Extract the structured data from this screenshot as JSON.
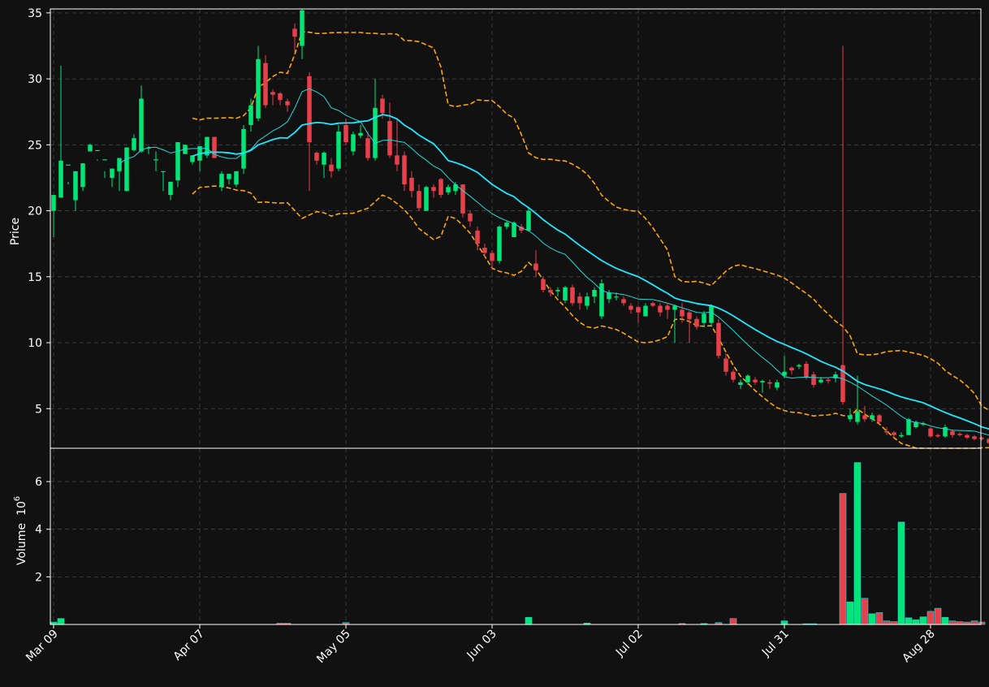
{
  "chart_data": {
    "type": "candlestick",
    "price_panel": {
      "ylabel": "Price",
      "ylim": [
        2,
        35.3
      ],
      "yticks": [
        5,
        10,
        15,
        20,
        25,
        30,
        35
      ],
      "grid": true
    },
    "volume_panel": {
      "ylabel": "Volume",
      "ylabel_exponent": "6",
      "ylim": [
        0,
        7.4
      ],
      "yticks": [
        2,
        4,
        6
      ],
      "grid": true
    },
    "x_tick_labels": [
      "Mar 09",
      "Apr 07",
      "May 05",
      "Jun 03",
      "Jul 02",
      "Jul 31",
      "Aug 28"
    ],
    "x_tick_index": [
      0,
      20,
      40,
      60,
      80,
      100,
      120
    ],
    "colors": {
      "up": "#00e676",
      "down": "#e8404a",
      "ma_fast": "#22d8d8",
      "ma_slow": "#1ee8ff",
      "bands": "#ffa500",
      "background": "#111111",
      "grid": "#444444"
    },
    "candles": [
      [
        20.0,
        21.2,
        18.0,
        21.2
      ],
      [
        21.0,
        23.8,
        21.0,
        31.0
      ],
      [
        23.5,
        23.5,
        22.0,
        22.2
      ],
      [
        20.8,
        23.0,
        20.0,
        23.0
      ],
      [
        21.8,
        23.6,
        21.5,
        23.6
      ],
      [
        24.5,
        25.0,
        24.5,
        25.1
      ],
      [
        24.6,
        24.6,
        23.8,
        23.9
      ],
      [
        23.9,
        23.9,
        22.5,
        23.0
      ],
      [
        22.5,
        23.2,
        21.8,
        23.2
      ],
      [
        23.0,
        24.0,
        21.5,
        24.0
      ],
      [
        21.5,
        24.8,
        21.5,
        24.8
      ],
      [
        24.6,
        25.5,
        24.5,
        25.8
      ],
      [
        24.5,
        28.5,
        24.4,
        29.5
      ],
      [
        24.8,
        24.8,
        24.3,
        24.9
      ],
      [
        23.9,
        23.9,
        23.0,
        24.5
      ],
      [
        23.0,
        23.0,
        21.5,
        23.0
      ],
      [
        21.2,
        22.2,
        20.8,
        22.2
      ],
      [
        22.3,
        25.2,
        21.8,
        25.2
      ],
      [
        24.3,
        25.0,
        24.3,
        25.0
      ],
      [
        23.7,
        24.2,
        23.5,
        24.2
      ],
      [
        23.8,
        24.9,
        23.0,
        24.9
      ],
      [
        24.2,
        25.6,
        24.0,
        25.6
      ],
      [
        25.6,
        24.0,
        24.0,
        25.6
      ],
      [
        21.8,
        22.8,
        21.5,
        23.0
      ],
      [
        22.4,
        22.8,
        22.0,
        22.8
      ],
      [
        22.0,
        23.0,
        21.8,
        23.0
      ],
      [
        23.2,
        26.2,
        22.8,
        26.5
      ],
      [
        26.5,
        28.0,
        26.0,
        28.5
      ],
      [
        27.0,
        31.5,
        26.8,
        32.5
      ],
      [
        31.2,
        28.0,
        27.8,
        31.8
      ],
      [
        29.0,
        28.8,
        28.0,
        29.2
      ],
      [
        28.9,
        28.4,
        28.0,
        29.0
      ],
      [
        28.3,
        28.0,
        27.5,
        28.5
      ],
      [
        33.8,
        33.2,
        32.0,
        34.2
      ],
      [
        32.5,
        35.2,
        31.5,
        35.5
      ],
      [
        30.2,
        25.2,
        21.5,
        30.5
      ],
      [
        24.4,
        23.8,
        23.5,
        24.5
      ],
      [
        23.5,
        24.4,
        22.5,
        24.5
      ],
      [
        23.5,
        23.0,
        22.5,
        24.0
      ],
      [
        23.2,
        26.0,
        23.0,
        26.5
      ],
      [
        26.5,
        25.2,
        25.0,
        27.0
      ],
      [
        24.5,
        25.8,
        24.2,
        26.0
      ],
      [
        25.7,
        25.9,
        25.5,
        26.5
      ],
      [
        25.5,
        24.0,
        23.8,
        26.0
      ],
      [
        24.0,
        27.8,
        23.8,
        30.0
      ],
      [
        28.5,
        27.4,
        27.0,
        28.8
      ],
      [
        26.8,
        24.2,
        24.0,
        28.2
      ],
      [
        24.2,
        23.5,
        23.0,
        27.0
      ],
      [
        24.2,
        22.0,
        21.5,
        24.5
      ],
      [
        22.5,
        21.5,
        21.0,
        23.0
      ],
      [
        21.5,
        20.2,
        20.0,
        22.0
      ],
      [
        20.0,
        21.8,
        20.0,
        21.9
      ],
      [
        21.8,
        21.5,
        21.0,
        22.0
      ],
      [
        22.4,
        21.2,
        21.0,
        22.5
      ],
      [
        21.4,
        21.8,
        21.2,
        22.0
      ],
      [
        21.5,
        22.0,
        21.2,
        22.2
      ],
      [
        22.0,
        19.8,
        19.5,
        22.0
      ],
      [
        19.8,
        19.2,
        18.8,
        20.0
      ],
      [
        18.5,
        17.5,
        17.0,
        18.8
      ],
      [
        17.2,
        16.8,
        16.5,
        17.5
      ],
      [
        16.8,
        16.2,
        15.5,
        17.0
      ],
      [
        16.2,
        18.8,
        16.0,
        18.9
      ],
      [
        18.8,
        19.1,
        18.6,
        19.2
      ],
      [
        18.0,
        19.1,
        18.0,
        19.2
      ],
      [
        18.8,
        18.5,
        18.3,
        19.0
      ],
      [
        18.5,
        20.0,
        18.4,
        20.2
      ],
      [
        16.0,
        15.5,
        15.0,
        17.0
      ],
      [
        14.8,
        14.0,
        13.8,
        15.0
      ],
      [
        14.0,
        13.8,
        13.5,
        14.2
      ],
      [
        13.9,
        14.0,
        13.5,
        14.2
      ],
      [
        13.2,
        14.2,
        13.0,
        14.3
      ],
      [
        14.2,
        13.0,
        12.8,
        14.4
      ],
      [
        13.5,
        13.0,
        12.5,
        13.8
      ],
      [
        12.8,
        13.5,
        12.5,
        13.8
      ],
      [
        13.5,
        14.0,
        13.0,
        14.2
      ],
      [
        12.0,
        14.5,
        11.8,
        14.8
      ],
      [
        13.3,
        13.8,
        13.0,
        14.0
      ],
      [
        13.5,
        13.5,
        13.2,
        13.8
      ],
      [
        13.3,
        13.0,
        12.8,
        13.5
      ],
      [
        12.8,
        12.5,
        12.2,
        13.0
      ],
      [
        12.7,
        12.3,
        11.5,
        12.8
      ],
      [
        12.0,
        12.8,
        12.0,
        13.0
      ],
      [
        13.0,
        12.8,
        12.7,
        13.1
      ],
      [
        12.8,
        12.3,
        12.0,
        13.0
      ],
      [
        12.8,
        12.5,
        11.8,
        13.0
      ],
      [
        12.5,
        12.8,
        10.0,
        12.9
      ],
      [
        12.5,
        12.0,
        11.5,
        13.0
      ],
      [
        12.3,
        11.8,
        10.0,
        12.4
      ],
      [
        11.8,
        11.2,
        11.0,
        12.0
      ],
      [
        11.5,
        12.2,
        11.2,
        12.4
      ],
      [
        11.5,
        12.8,
        11.2,
        12.9
      ],
      [
        11.5,
        9.0,
        8.8,
        11.8
      ],
      [
        8.8,
        7.8,
        7.5,
        9.2
      ],
      [
        7.8,
        7.2,
        7.0,
        8.0
      ],
      [
        6.8,
        7.0,
        6.5,
        7.2
      ],
      [
        7.0,
        7.5,
        6.8,
        7.6
      ],
      [
        7.2,
        7.0,
        6.8,
        7.4
      ],
      [
        7.0,
        7.1,
        6.2,
        7.2
      ],
      [
        7.0,
        6.9,
        6.5,
        7.2
      ],
      [
        6.6,
        7.0,
        6.4,
        7.2
      ],
      [
        7.5,
        7.8,
        7.3,
        9.0
      ],
      [
        8.1,
        7.9,
        7.6,
        8.2
      ],
      [
        8.2,
        8.3,
        8.0,
        8.4
      ],
      [
        8.4,
        7.4,
        7.2,
        8.6
      ],
      [
        7.6,
        6.8,
        6.6,
        7.8
      ],
      [
        7.0,
        7.2,
        6.9,
        7.4
      ],
      [
        7.2,
        7.1,
        6.9,
        7.3
      ],
      [
        7.3,
        7.6,
        7.0,
        7.8
      ],
      [
        8.3,
        5.5,
        5.3,
        32.5
      ],
      [
        4.2,
        4.5,
        4.0,
        5.0
      ],
      [
        4.0,
        4.8,
        3.8,
        7.5
      ],
      [
        4.5,
        4.2,
        4.0,
        5.2
      ],
      [
        4.2,
        4.5,
        4.0,
        4.7
      ],
      [
        4.5,
        4.0,
        3.8,
        4.6
      ],
      [
        3.3,
        3.2,
        3.0,
        3.6
      ],
      [
        3.2,
        3.0,
        2.8,
        3.3
      ],
      [
        2.9,
        3.0,
        2.8,
        3.2
      ],
      [
        3.0,
        4.2,
        3.0,
        4.3
      ],
      [
        3.6,
        4.0,
        3.5,
        4.1
      ],
      [
        3.8,
        3.9,
        3.7,
        4.0
      ],
      [
        3.5,
        2.9,
        2.8,
        3.6
      ],
      [
        3.0,
        2.9,
        2.8,
        3.1
      ],
      [
        2.9,
        3.6,
        2.8,
        3.8
      ],
      [
        3.3,
        3.0,
        2.8,
        3.4
      ],
      [
        3.1,
        3.0,
        2.9,
        3.2
      ],
      [
        3.0,
        2.8,
        2.7,
        3.1
      ],
      [
        2.9,
        2.7,
        2.6,
        3.0
      ],
      [
        2.8,
        2.7,
        2.6,
        2.9
      ],
      [
        2.7,
        2.4,
        2.3,
        2.8
      ],
      [
        2.2,
        2.5,
        2.1,
        2.6
      ]
    ],
    "volume_millions": [
      0.1,
      0.25,
      0,
      0,
      0,
      0,
      0,
      0,
      0,
      0,
      0,
      0,
      0,
      0,
      0,
      0,
      0,
      0,
      0,
      0,
      0,
      0,
      0,
      0,
      0,
      0,
      0,
      0,
      0,
      0,
      0,
      0.05,
      0.05,
      0,
      0,
      0,
      0,
      0,
      0,
      0,
      0.08,
      0,
      0,
      0,
      0,
      0,
      0,
      0,
      0,
      0,
      0,
      0,
      0,
      0,
      0,
      0,
      0,
      0,
      0,
      0,
      0,
      0,
      0,
      0,
      0,
      0.3,
      0,
      0,
      0,
      0,
      0,
      0,
      0,
      0.06,
      0,
      0,
      0,
      0,
      0,
      0,
      0,
      0,
      0,
      0,
      0,
      0,
      0.04,
      0,
      0,
      0.04,
      0,
      0.08,
      0,
      0.25,
      0,
      0,
      0,
      0,
      0,
      0,
      0.15,
      0,
      0,
      0.03,
      0.03,
      0,
      0,
      0,
      5.5,
      0.95,
      6.8,
      1.1,
      0.45,
      0.5,
      0.15,
      0.12,
      4.3,
      0.28,
      0.2,
      0.32,
      0.55,
      0.68,
      0.3,
      0.15,
      0.12,
      0.1,
      0.15,
      0.1
    ]
  }
}
